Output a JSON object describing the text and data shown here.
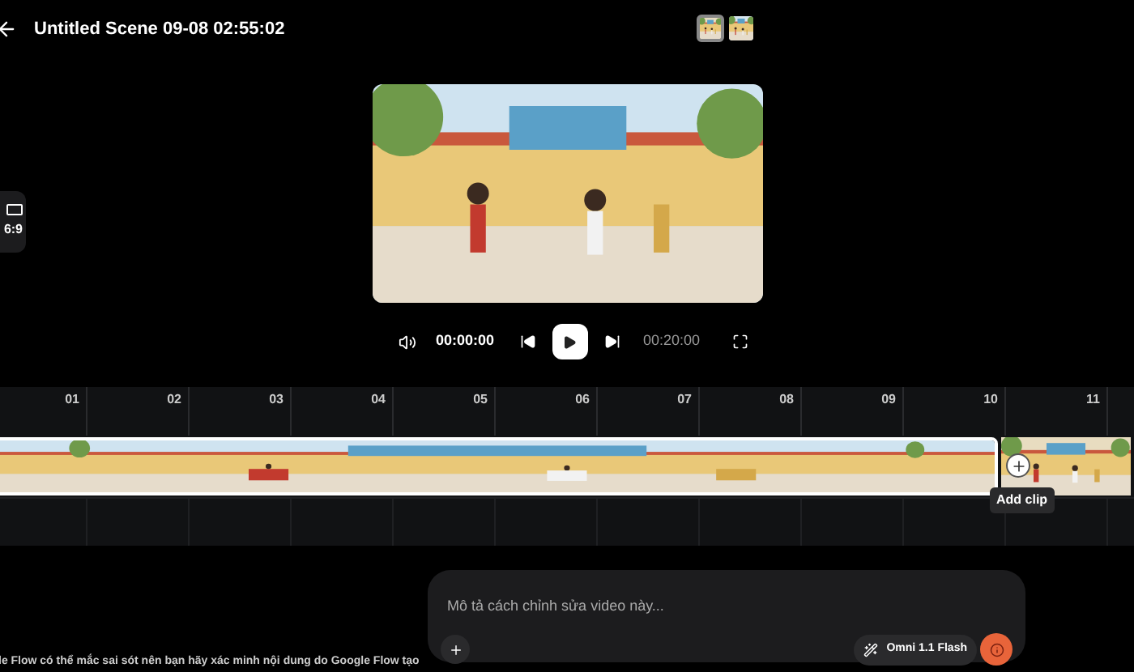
{
  "header": {
    "title": "Untitled Scene 09-08 02:55:02",
    "thumbnails": [
      {
        "kind": "picture",
        "selected": true
      },
      {
        "kind": "picture",
        "selected": false
      }
    ]
  },
  "aspect": {
    "label": "6:9"
  },
  "player": {
    "current_time": "00:00:00",
    "total_time": "00:20:00"
  },
  "timeline": {
    "ticks": [
      "01",
      "02",
      "03",
      "04",
      "05",
      "06",
      "07",
      "08",
      "09",
      "10",
      "11"
    ],
    "add_clip": {
      "tooltip": "Add clip"
    }
  },
  "prompt": {
    "placeholder": "Mô tả cách chỉnh sửa video này...",
    "model": "Omni 1.1 Flash"
  },
  "disclaimer": "le Flow có thể mắc sai sót nên bạn hãy xác minh nội dung do Google Flow tạo"
}
